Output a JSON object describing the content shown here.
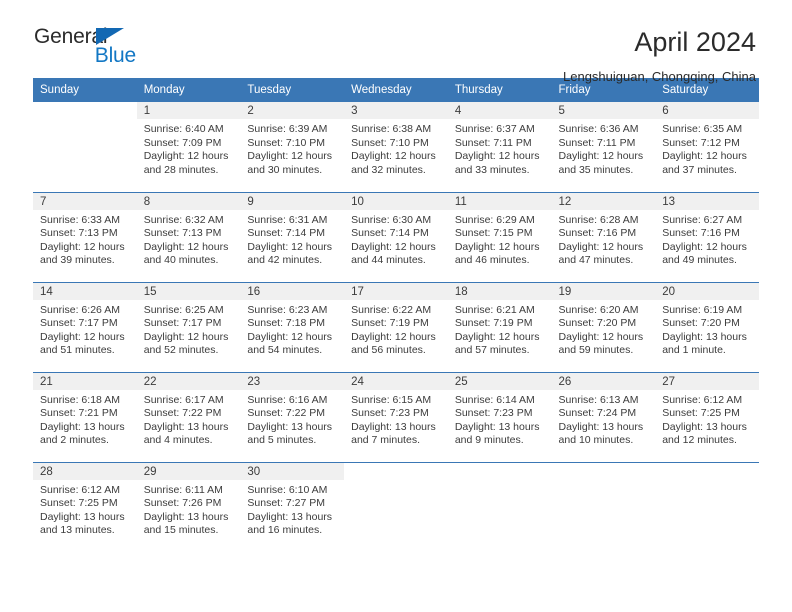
{
  "brand": {
    "name_top": "General",
    "name_bottom": "Blue",
    "triangle_icon": "triangle-icon",
    "accent_color": "#1268b3"
  },
  "header": {
    "title": "April 2024",
    "subtitle": "Lengshuiguan, Chongqing, China"
  },
  "colors": {
    "header_blue": "#3a77b5",
    "daynum_band": "#f0f0f0",
    "text": "#3c3c3c"
  },
  "calendar": {
    "weekday_headers": [
      "Sunday",
      "Monday",
      "Tuesday",
      "Wednesday",
      "Thursday",
      "Friday",
      "Saturday"
    ],
    "weeks": [
      [
        {
          "day": "",
          "sunrise": "",
          "sunset": "",
          "daylight_line1": "",
          "daylight_line2": "",
          "blank": true
        },
        {
          "day": "1",
          "sunrise": "Sunrise: 6:40 AM",
          "sunset": "Sunset: 7:09 PM",
          "daylight_line1": "Daylight: 12 hours",
          "daylight_line2": "and 28 minutes."
        },
        {
          "day": "2",
          "sunrise": "Sunrise: 6:39 AM",
          "sunset": "Sunset: 7:10 PM",
          "daylight_line1": "Daylight: 12 hours",
          "daylight_line2": "and 30 minutes."
        },
        {
          "day": "3",
          "sunrise": "Sunrise: 6:38 AM",
          "sunset": "Sunset: 7:10 PM",
          "daylight_line1": "Daylight: 12 hours",
          "daylight_line2": "and 32 minutes."
        },
        {
          "day": "4",
          "sunrise": "Sunrise: 6:37 AM",
          "sunset": "Sunset: 7:11 PM",
          "daylight_line1": "Daylight: 12 hours",
          "daylight_line2": "and 33 minutes."
        },
        {
          "day": "5",
          "sunrise": "Sunrise: 6:36 AM",
          "sunset": "Sunset: 7:11 PM",
          "daylight_line1": "Daylight: 12 hours",
          "daylight_line2": "and 35 minutes."
        },
        {
          "day": "6",
          "sunrise": "Sunrise: 6:35 AM",
          "sunset": "Sunset: 7:12 PM",
          "daylight_line1": "Daylight: 12 hours",
          "daylight_line2": "and 37 minutes."
        }
      ],
      [
        {
          "day": "7",
          "sunrise": "Sunrise: 6:33 AM",
          "sunset": "Sunset: 7:13 PM",
          "daylight_line1": "Daylight: 12 hours",
          "daylight_line2": "and 39 minutes."
        },
        {
          "day": "8",
          "sunrise": "Sunrise: 6:32 AM",
          "sunset": "Sunset: 7:13 PM",
          "daylight_line1": "Daylight: 12 hours",
          "daylight_line2": "and 40 minutes."
        },
        {
          "day": "9",
          "sunrise": "Sunrise: 6:31 AM",
          "sunset": "Sunset: 7:14 PM",
          "daylight_line1": "Daylight: 12 hours",
          "daylight_line2": "and 42 minutes."
        },
        {
          "day": "10",
          "sunrise": "Sunrise: 6:30 AM",
          "sunset": "Sunset: 7:14 PM",
          "daylight_line1": "Daylight: 12 hours",
          "daylight_line2": "and 44 minutes."
        },
        {
          "day": "11",
          "sunrise": "Sunrise: 6:29 AM",
          "sunset": "Sunset: 7:15 PM",
          "daylight_line1": "Daylight: 12 hours",
          "daylight_line2": "and 46 minutes."
        },
        {
          "day": "12",
          "sunrise": "Sunrise: 6:28 AM",
          "sunset": "Sunset: 7:16 PM",
          "daylight_line1": "Daylight: 12 hours",
          "daylight_line2": "and 47 minutes."
        },
        {
          "day": "13",
          "sunrise": "Sunrise: 6:27 AM",
          "sunset": "Sunset: 7:16 PM",
          "daylight_line1": "Daylight: 12 hours",
          "daylight_line2": "and 49 minutes."
        }
      ],
      [
        {
          "day": "14",
          "sunrise": "Sunrise: 6:26 AM",
          "sunset": "Sunset: 7:17 PM",
          "daylight_line1": "Daylight: 12 hours",
          "daylight_line2": "and 51 minutes."
        },
        {
          "day": "15",
          "sunrise": "Sunrise: 6:25 AM",
          "sunset": "Sunset: 7:17 PM",
          "daylight_line1": "Daylight: 12 hours",
          "daylight_line2": "and 52 minutes."
        },
        {
          "day": "16",
          "sunrise": "Sunrise: 6:23 AM",
          "sunset": "Sunset: 7:18 PM",
          "daylight_line1": "Daylight: 12 hours",
          "daylight_line2": "and 54 minutes."
        },
        {
          "day": "17",
          "sunrise": "Sunrise: 6:22 AM",
          "sunset": "Sunset: 7:19 PM",
          "daylight_line1": "Daylight: 12 hours",
          "daylight_line2": "and 56 minutes."
        },
        {
          "day": "18",
          "sunrise": "Sunrise: 6:21 AM",
          "sunset": "Sunset: 7:19 PM",
          "daylight_line1": "Daylight: 12 hours",
          "daylight_line2": "and 57 minutes."
        },
        {
          "day": "19",
          "sunrise": "Sunrise: 6:20 AM",
          "sunset": "Sunset: 7:20 PM",
          "daylight_line1": "Daylight: 12 hours",
          "daylight_line2": "and 59 minutes."
        },
        {
          "day": "20",
          "sunrise": "Sunrise: 6:19 AM",
          "sunset": "Sunset: 7:20 PM",
          "daylight_line1": "Daylight: 13 hours",
          "daylight_line2": "and 1 minute."
        }
      ],
      [
        {
          "day": "21",
          "sunrise": "Sunrise: 6:18 AM",
          "sunset": "Sunset: 7:21 PM",
          "daylight_line1": "Daylight: 13 hours",
          "daylight_line2": "and 2 minutes."
        },
        {
          "day": "22",
          "sunrise": "Sunrise: 6:17 AM",
          "sunset": "Sunset: 7:22 PM",
          "daylight_line1": "Daylight: 13 hours",
          "daylight_line2": "and 4 minutes."
        },
        {
          "day": "23",
          "sunrise": "Sunrise: 6:16 AM",
          "sunset": "Sunset: 7:22 PM",
          "daylight_line1": "Daylight: 13 hours",
          "daylight_line2": "and 5 minutes."
        },
        {
          "day": "24",
          "sunrise": "Sunrise: 6:15 AM",
          "sunset": "Sunset: 7:23 PM",
          "daylight_line1": "Daylight: 13 hours",
          "daylight_line2": "and 7 minutes."
        },
        {
          "day": "25",
          "sunrise": "Sunrise: 6:14 AM",
          "sunset": "Sunset: 7:23 PM",
          "daylight_line1": "Daylight: 13 hours",
          "daylight_line2": "and 9 minutes."
        },
        {
          "day": "26",
          "sunrise": "Sunrise: 6:13 AM",
          "sunset": "Sunset: 7:24 PM",
          "daylight_line1": "Daylight: 13 hours",
          "daylight_line2": "and 10 minutes."
        },
        {
          "day": "27",
          "sunrise": "Sunrise: 6:12 AM",
          "sunset": "Sunset: 7:25 PM",
          "daylight_line1": "Daylight: 13 hours",
          "daylight_line2": "and 12 minutes."
        }
      ],
      [
        {
          "day": "28",
          "sunrise": "Sunrise: 6:12 AM",
          "sunset": "Sunset: 7:25 PM",
          "daylight_line1": "Daylight: 13 hours",
          "daylight_line2": "and 13 minutes."
        },
        {
          "day": "29",
          "sunrise": "Sunrise: 6:11 AM",
          "sunset": "Sunset: 7:26 PM",
          "daylight_line1": "Daylight: 13 hours",
          "daylight_line2": "and 15 minutes."
        },
        {
          "day": "30",
          "sunrise": "Sunrise: 6:10 AM",
          "sunset": "Sunset: 7:27 PM",
          "daylight_line1": "Daylight: 13 hours",
          "daylight_line2": "and 16 minutes."
        },
        {
          "day": "",
          "sunrise": "",
          "sunset": "",
          "daylight_line1": "",
          "daylight_line2": "",
          "blank": true
        },
        {
          "day": "",
          "sunrise": "",
          "sunset": "",
          "daylight_line1": "",
          "daylight_line2": "",
          "blank": true
        },
        {
          "day": "",
          "sunrise": "",
          "sunset": "",
          "daylight_line1": "",
          "daylight_line2": "",
          "blank": true
        },
        {
          "day": "",
          "sunrise": "",
          "sunset": "",
          "daylight_line1": "",
          "daylight_line2": "",
          "blank": true
        }
      ]
    ]
  }
}
